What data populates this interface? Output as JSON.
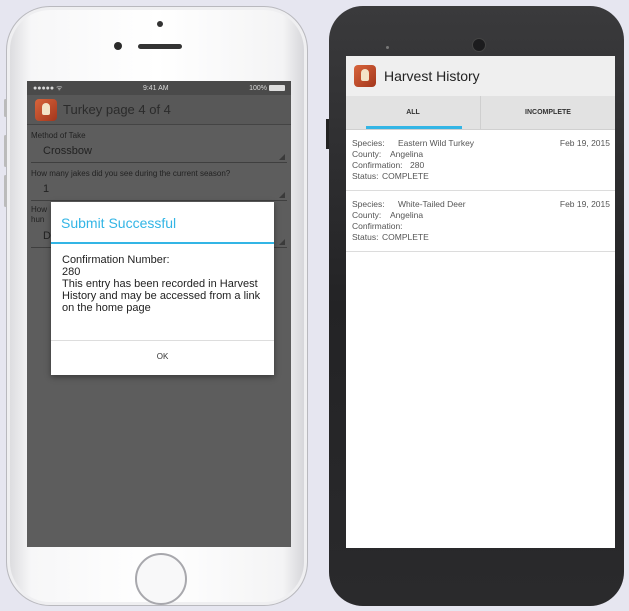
{
  "iphone": {
    "status": {
      "carrier": "●●●●● ᯤ",
      "time": "9:41 AM",
      "battery": "100%"
    },
    "header_title": "Turkey page 4 of 4",
    "form": {
      "method_label": "Method of Take",
      "method_value": "Crossbow",
      "jakes_label": "How many jakes did you see during the current season?",
      "jakes_value": "1",
      "hidden_label_1": "How",
      "hidden_label_2": "hun",
      "hidden_value": "D"
    },
    "dialog": {
      "title": "Submit Successful",
      "conf_label": "Confirmation Number:",
      "conf_number": "280",
      "message": "This entry has been recorded in Harvest History and may be accessed from a link on the home page",
      "ok_label": "OK"
    }
  },
  "android": {
    "header_title": "Harvest History",
    "tabs": [
      {
        "label": "ALL",
        "active": true
      },
      {
        "label": "INCOMPLETE",
        "active": false
      }
    ],
    "records": [
      {
        "species_key": "Species:",
        "species": "Eastern Wild Turkey",
        "county_key": "County:",
        "county": "Angelina",
        "conf_key": "Confirmation:",
        "confirmation": "280",
        "status_key": "Status:",
        "status": "COMPLETE",
        "date": "Feb 19, 2015"
      },
      {
        "species_key": "Species:",
        "species": "White-Tailed Deer",
        "county_key": "County:",
        "county": "Angelina",
        "conf_key": "Confirmation:",
        "confirmation": "",
        "status_key": "Status:",
        "status": "COMPLETE",
        "date": "Feb 19, 2015"
      }
    ]
  },
  "colors": {
    "accent": "#33b5e5",
    "app_icon": "#c24a28"
  }
}
